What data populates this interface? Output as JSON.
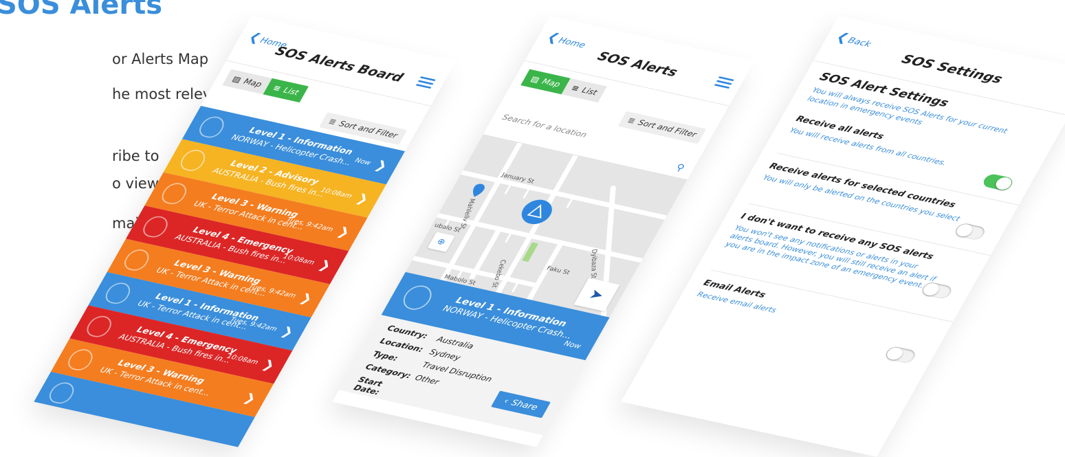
{
  "left": {
    "heading": "SOS Alerts",
    "lines": [
      "or Alerts Map",
      "he most relevant",
      "ribe to",
      "o view",
      "mails"
    ]
  },
  "board": {
    "back_label": "Home",
    "title": "SOS Alerts Board",
    "map_toggle": "Map",
    "list_toggle": "List",
    "sort_label": "Sort and Filter",
    "alerts": [
      {
        "level": "Level 1 - Information",
        "desc": "NORWAY - Helicopter Crash...",
        "time": "Now",
        "color": "#3a8edb"
      },
      {
        "level": "Level 2 - Advisory",
        "desc": "AUSTRALIA - Bush fires in...",
        "time": "10:08am",
        "color": "#f6b322"
      },
      {
        "level": "Level 3 - Warning",
        "desc": "UK - Terror Attack in cent...",
        "time": "Tues, 9:42am",
        "color": "#f47d20"
      },
      {
        "level": "Level 4 - Emergency",
        "desc": "AUSTRALIA - Bush fires in...",
        "time": "10:08am",
        "color": "#dc2626"
      },
      {
        "level": "Level 3 - Warning",
        "desc": "UK - Terror Attack in cent...",
        "time": "Tues, 9:42am",
        "color": "#f47d20"
      },
      {
        "level": "Level 1 - Information",
        "desc": "UK - Terror Attack in cent...",
        "time": "Tues, 9:42am",
        "color": "#3a8edb"
      },
      {
        "level": "Level 4 - Emergency",
        "desc": "AUSTRALIA - Bush fires in...",
        "time": "10:08am",
        "color": "#dc2626"
      },
      {
        "level": "Level 3 - Warning",
        "desc": "UK - Terror Attack in cent...",
        "time": "",
        "color": "#f47d20"
      },
      {
        "level": "",
        "desc": "",
        "time": "",
        "color": "#3a8edb"
      }
    ]
  },
  "map_screen": {
    "back_label": "Home",
    "title": "SOS Alerts",
    "map_toggle": "Map",
    "list_toggle": "List",
    "sort_label": "Sort and Filter",
    "search_placeholder": "Search for a location",
    "streets": [
      "January St",
      "Mahleliv St",
      "Cekebo St",
      "Faku St",
      "Dyibaza St",
      "Mabolo St",
      "ubalo St",
      "St"
    ],
    "card": {
      "level": "Level 1 - Information",
      "desc": "NORWAY - Helicopter Crash...",
      "time": "Now"
    },
    "details": [
      {
        "label": "Country:",
        "value": "Australia"
      },
      {
        "label": "Location:",
        "value": "Sydney"
      },
      {
        "label": "Type:",
        "value": "Travel Disruption"
      },
      {
        "label": "Category:",
        "value": "Other"
      },
      {
        "label": "Start Date:",
        "value": ""
      }
    ],
    "share_label": "Share"
  },
  "settings": {
    "back_label": "Back",
    "title": "SOS Settings",
    "section_title": "SOS Alert Settings",
    "section_desc": "You will always receive SOS Alerts for your current location in emergency events",
    "rows": [
      {
        "title": "Receive all alerts",
        "desc": "You will receive alerts from all countries.",
        "on": true
      },
      {
        "title": "Receive alerts for selected countries",
        "desc": "You will only be alerted on the countries you select",
        "on": false
      },
      {
        "title": "I don't want to receive any SOS alerts",
        "desc": "You won't see any notifications or alerts in your alerts board. However, you will still receive an alert if you are in the impact zone of an emergency event.",
        "on": false
      },
      {
        "title": "Email Alerts",
        "desc": "Receive email alerts",
        "on": false
      }
    ]
  },
  "colors": {
    "accent": "#3a8edb",
    "green": "#3bb54a",
    "info": "#3a8edb",
    "advisory": "#f6b322",
    "warning": "#f47d20",
    "emergency": "#dc2626"
  }
}
